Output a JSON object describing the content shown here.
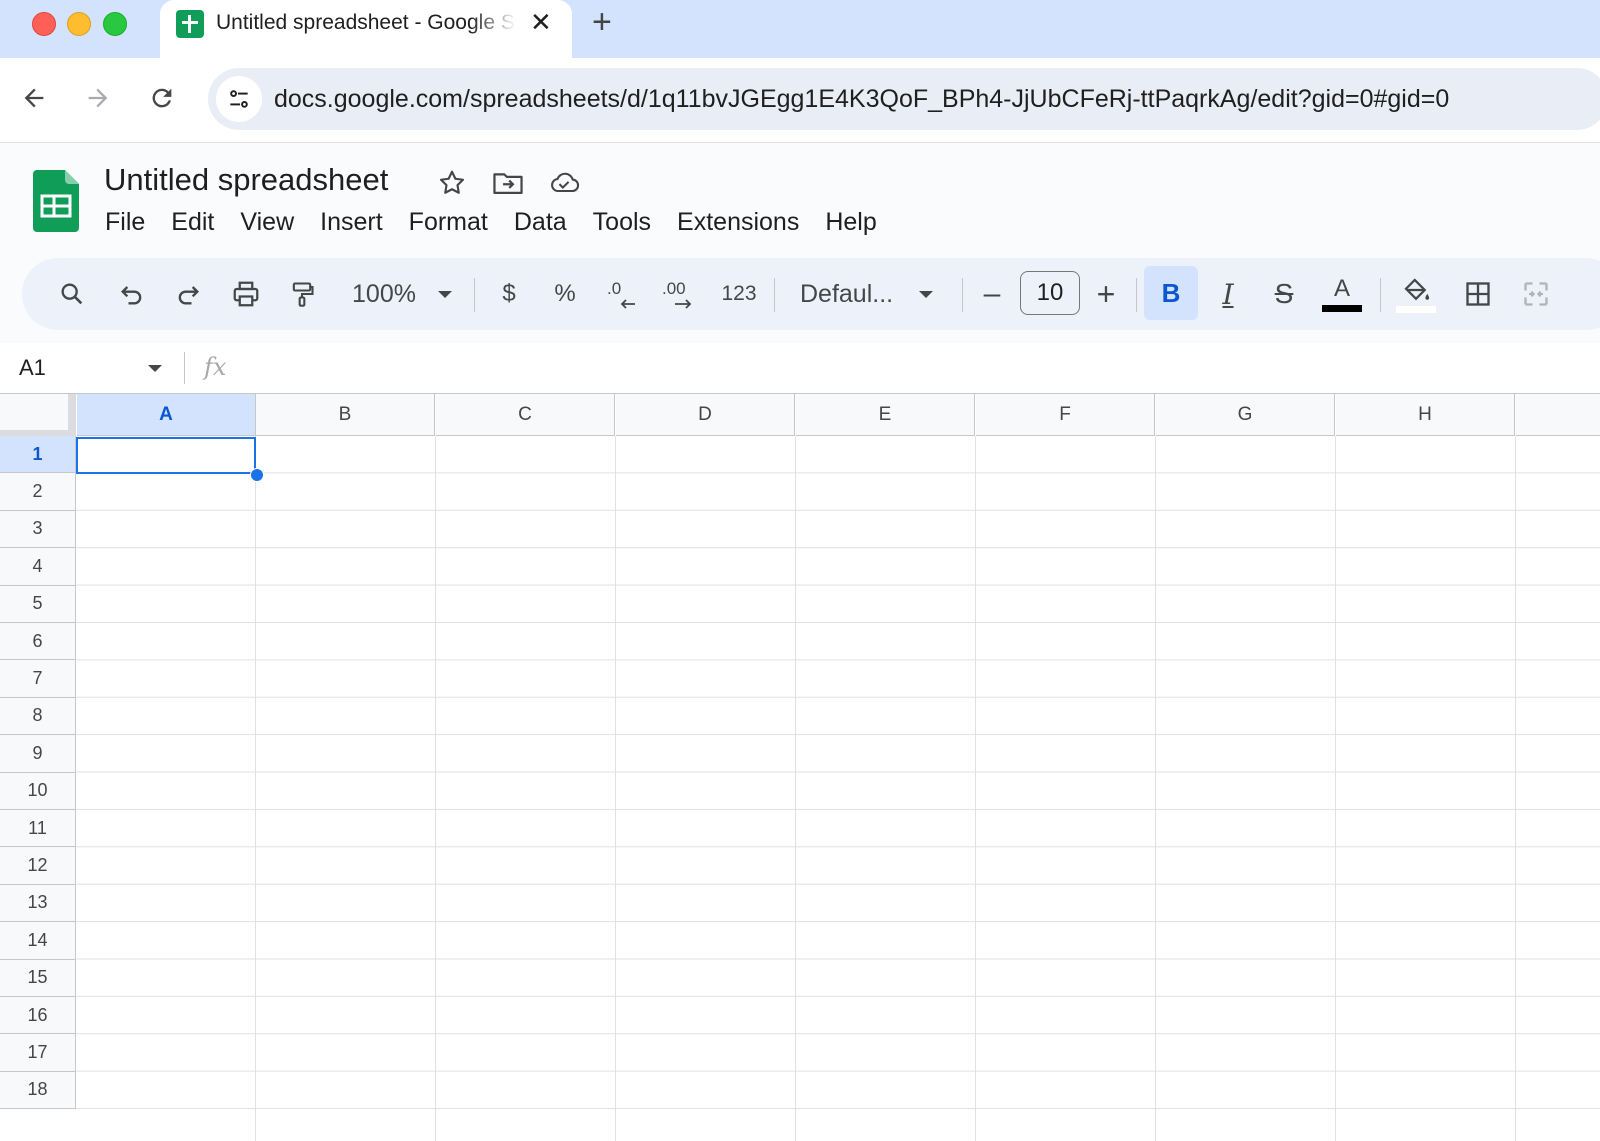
{
  "browser": {
    "tab_title": "Untitled spreadsheet - Google Sheets",
    "tab_close": "✕",
    "new_tab": "+",
    "url": "docs.google.com/spreadsheets/d/1q11bvJGEgg1E4K3QoF_BPh4-JjUbCFeRj-ttPaqrkAg/edit?gid=0#gid=0"
  },
  "app": {
    "title": "Untitled spreadsheet",
    "menus": [
      "File",
      "Edit",
      "View",
      "Insert",
      "Format",
      "Data",
      "Tools",
      "Extensions",
      "Help"
    ]
  },
  "toolbar": {
    "zoom": "100%",
    "currency": "$",
    "percent": "%",
    "number_format": "123",
    "font": "Defaul...",
    "font_size": "10",
    "decrease_size": "–",
    "increase_size": "+",
    "bold": "B",
    "italic": "I",
    "strikethrough": "S",
    "text_color_letter": "A",
    "text_color": "#000000",
    "fill_color": "#ffffff"
  },
  "formula_bar": {
    "name_box": "A1",
    "fx_label": "fx",
    "value": ""
  },
  "grid": {
    "columns": [
      "A",
      "B",
      "C",
      "D",
      "E",
      "F",
      "G",
      "H"
    ],
    "rows": [
      "1",
      "2",
      "3",
      "4",
      "5",
      "6",
      "7",
      "8",
      "9",
      "10",
      "11",
      "12",
      "13",
      "14",
      "15",
      "16",
      "17",
      "18"
    ],
    "selected_cell": "A1",
    "selected_column": "A",
    "selected_row": "1"
  },
  "colors": {
    "accent": "#1a73e8",
    "selection_header": "#d3e3fd",
    "sheets_green": "#0f9d58"
  }
}
